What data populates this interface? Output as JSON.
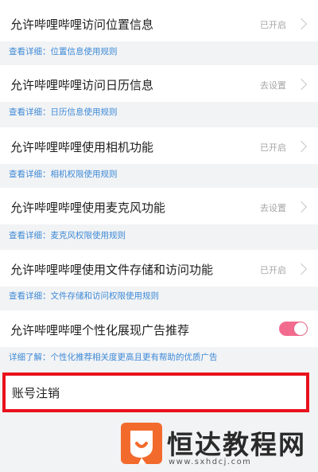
{
  "permissions": [
    {
      "title": "允许哔哩哔哩访问位置信息",
      "status": "已开启",
      "detail": "查看详细：位置信息使用规则"
    },
    {
      "title": "允许哔哩哔哩访问日历信息",
      "status": "去设置",
      "detail": "查看详细：日历信息使用规则"
    },
    {
      "title": "允许哔哩哔哩使用相机功能",
      "status": "已开启",
      "detail": "查看详细：相机权限使用规则"
    },
    {
      "title": "允许哔哩哔哩使用麦克风功能",
      "status": "去设置",
      "detail": "查看详细：麦克风权限使用规则"
    },
    {
      "title": "允许哔哩哔哩使用文件存储和访问功能",
      "status": "已开启",
      "detail": "查看详细：文件存储和访问权限使用规则"
    }
  ],
  "ad_personalization": {
    "title": "允许哔哩哔哩个性化展现广告推荐",
    "enabled": true,
    "detail": "详细了解：个性化推荐相关度更高且更有帮助的优质广告"
  },
  "account_cancel": {
    "label": "账号注销"
  },
  "watermark": {
    "brand": "恒达教程网",
    "url": "www.sxhdcj.com"
  },
  "colors": {
    "accent_link": "#3d8ad6",
    "toggle_on": "#f26b8e",
    "highlight": "#e8111c",
    "logo": "#f36b2c"
  }
}
